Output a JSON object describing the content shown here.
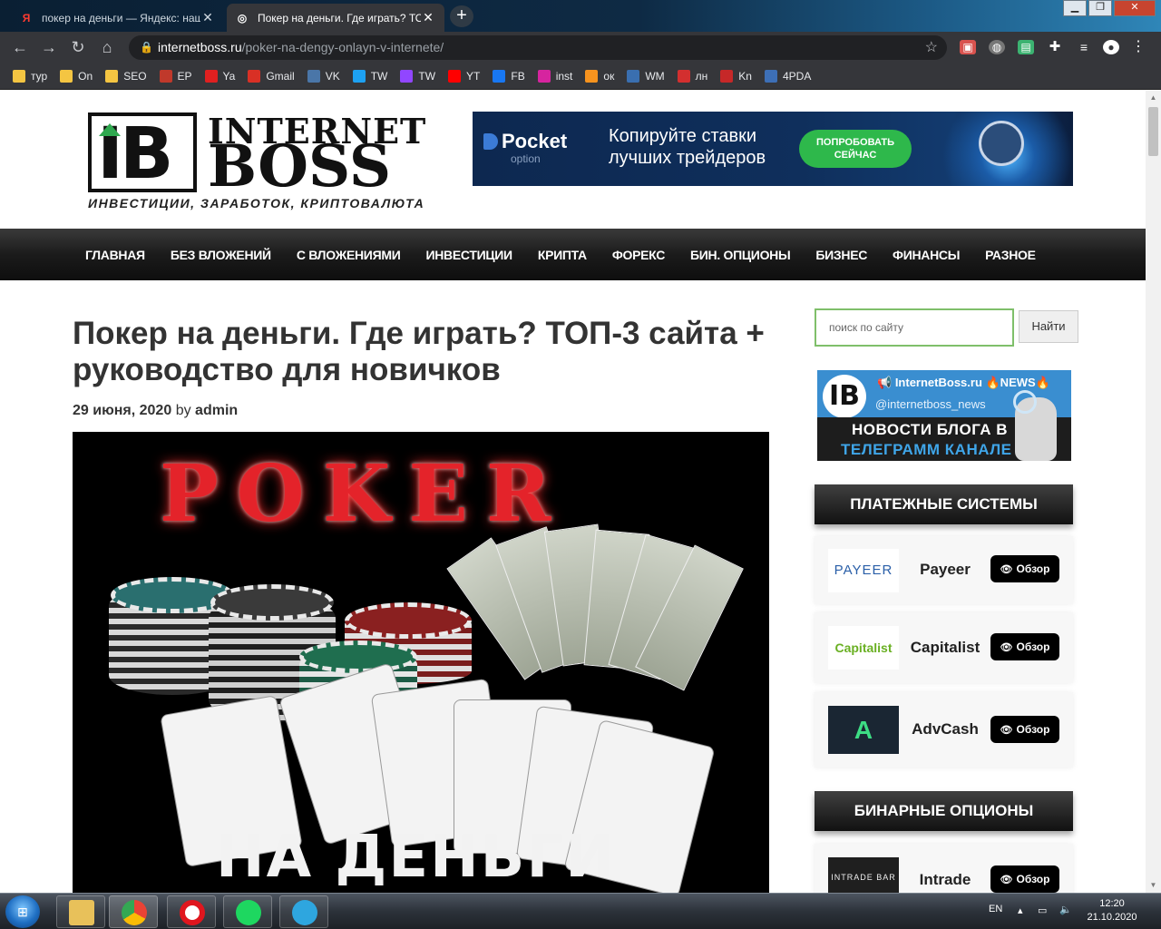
{
  "browser": {
    "tabs": [
      {
        "title": "покер на деньги — Яндекс: наш",
        "favicon": "Я"
      },
      {
        "title": "Покер на деньги. Где играть? ТО",
        "favicon": "◎"
      }
    ],
    "new_tab": "+",
    "url_host": "internetboss.ru",
    "url_path": "/poker-na-dengy-onlayn-v-internete/",
    "bookmarks": [
      {
        "label": "тур",
        "icon": "folder-icon",
        "color": "#f4c542"
      },
      {
        "label": "On",
        "icon": "folder-icon",
        "color": "#f4c542"
      },
      {
        "label": "SEO",
        "icon": "folder-icon",
        "color": "#f4c542"
      },
      {
        "label": "EP",
        "icon": "ep-icon",
        "color": "#c0392b"
      },
      {
        "label": "Ya",
        "icon": "yandex-icon",
        "color": "#e02020"
      },
      {
        "label": "Gmail",
        "icon": "gmail-icon",
        "color": "#d93025"
      },
      {
        "label": "VK",
        "icon": "vk-icon",
        "color": "#4a76a8"
      },
      {
        "label": "TW",
        "icon": "twitter-icon",
        "color": "#1da1f2"
      },
      {
        "label": "TW",
        "icon": "twitch-icon",
        "color": "#9146ff"
      },
      {
        "label": "YT",
        "icon": "youtube-icon",
        "color": "#ff0000"
      },
      {
        "label": "FB",
        "icon": "facebook-icon",
        "color": "#1877f2"
      },
      {
        "label": "inst",
        "icon": "instagram-icon",
        "color": "#d6249f"
      },
      {
        "label": "ок",
        "icon": "odnoklassniki-icon",
        "color": "#f7931e"
      },
      {
        "label": "WM",
        "icon": "webmoney-icon",
        "color": "#3a6fb0"
      },
      {
        "label": "лн",
        "icon": "liveinternet-icon",
        "color": "#d32f2f"
      },
      {
        "label": "Kn",
        "icon": "kinopoisk-icon",
        "color": "#c62828"
      },
      {
        "label": "4PDA",
        "icon": "4pda-icon",
        "color": "#3d6fb6"
      }
    ]
  },
  "site": {
    "logo_word1": "INTERNET",
    "logo_word2": "BOSS",
    "logo_mark": "IB",
    "tagline": "ИНВЕСТИЦИИ, ЗАРАБОТОК, КРИПТОВАЛЮТА",
    "banner": {
      "brand": "Pocket",
      "brand_sub": "option",
      "text_line1": "Копируйте ставки",
      "text_line2": "лучших трейдеров",
      "cta_line1": "ПОПРОБОВАТЬ",
      "cta_line2": "СЕЙЧАС"
    },
    "nav": [
      "ГЛАВНАЯ",
      "БЕЗ ВЛОЖЕНИЙ",
      "С ВЛОЖЕНИЯМИ",
      "ИНВЕСТИЦИИ",
      "КРИПТА",
      "ФОРЕКС",
      "БИН. ОПЦИОНЫ",
      "БИЗНЕС",
      "ФИНАНСЫ",
      "РАЗНОЕ"
    ]
  },
  "article": {
    "title": "Покер на деньги. Где играть? ТОП-3 сайта + руководство для новичков",
    "date": "29 июня, 2020",
    "by": "by",
    "author": "admin",
    "image_title_top": "POKER",
    "image_title_bottom": "НА ДЕНЬГИ"
  },
  "sidebar": {
    "search_placeholder": "поиск по сайту",
    "search_button": "Найти",
    "telegram": {
      "name": "InternetBoss.ru 🔥NEWS🔥",
      "handle": "@internetboss_news",
      "line1": "НОВОСТИ БЛОГА В",
      "line2": "ТЕЛЕГРАММ КАНАЛЕ"
    },
    "payments_title": "ПЛАТЕЖНЫЕ СИСТЕМЫ",
    "payments": [
      {
        "logo": "PAYEER",
        "name": "Payeer",
        "button": "Обзор"
      },
      {
        "logo": "Capitalist",
        "name": "Capitalist",
        "button": "Обзор"
      },
      {
        "logo": "A",
        "name": "AdvCash",
        "button": "Обзор"
      }
    ],
    "binary_title": "БИНАРНЫЕ ОПЦИОНЫ",
    "binary": [
      {
        "logo": "INTRADE BAR",
        "name": "Intrade",
        "button": "Обзор"
      }
    ]
  },
  "taskbar": {
    "lang": "EN",
    "time": "12:20",
    "date": "21.10.2020"
  },
  "colors": {
    "accent_green": "#2eb84b",
    "nav_bg": "#1b1b1b",
    "telegram_blue": "#3a8ed0"
  }
}
